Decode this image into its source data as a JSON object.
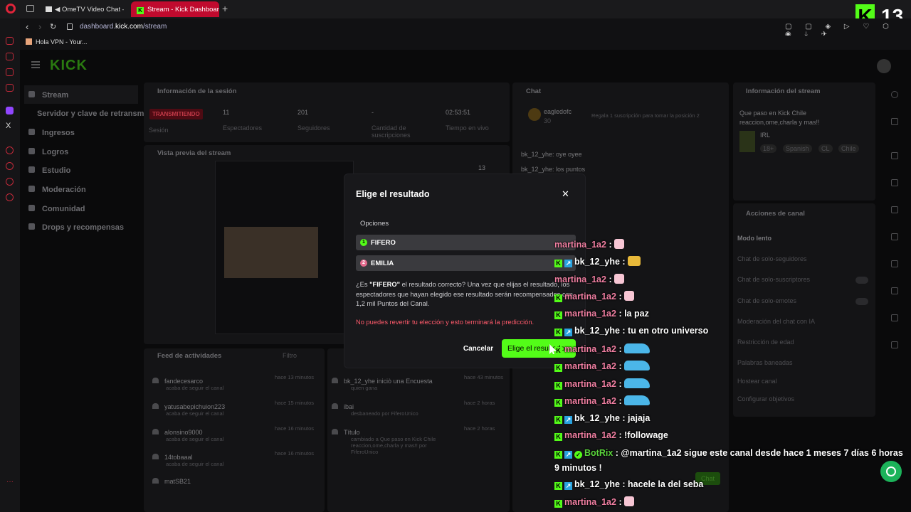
{
  "browser": {
    "tabs": [
      {
        "label": "OmeTV Video Chat —"
      },
      {
        "label": "Stream - Kick Dashboard"
      }
    ],
    "url_prefix": "dashboard.",
    "url_domain": "kick.com",
    "url_path": "/stream",
    "bookmark": "Hola VPN - Your..."
  },
  "overlay_counter": {
    "logo": "K",
    "value": "13"
  },
  "kick": {
    "logo_text": "KICK"
  },
  "sidebar": {
    "items": [
      {
        "label": "Stream"
      },
      {
        "label": "Servidor y clave de retransm"
      },
      {
        "label": "Ingresos"
      },
      {
        "label": "Logros"
      },
      {
        "label": "Estudio"
      },
      {
        "label": "Moderación"
      },
      {
        "label": "Comunidad"
      },
      {
        "label": "Drops y recompensas"
      }
    ]
  },
  "session": {
    "title": "Información de la sesión",
    "live_label": "TRANSMITIENDO",
    "session_label": "Sesión",
    "viewers": "11",
    "viewers_label": "Espectadores",
    "followers": "201",
    "followers_label": "Seguidores",
    "subs": "-",
    "subs_label": "Cantidad de suscripciones",
    "time": "02:53:51",
    "time_label": "Tiempo en vivo"
  },
  "preview": {
    "title": "Vista previa del stream",
    "count": "13"
  },
  "activity": {
    "title": "Feed de actividades",
    "filter": "Filtro",
    "items": [
      {
        "name": "fandecesarco",
        "desc": "acaba de seguir el canal",
        "time": "hace 13 minutos"
      },
      {
        "name": "yatusabepichuion223",
        "desc": "acaba de seguir el canal",
        "time": "hace 15 minutos"
      },
      {
        "name": "alonsino9000",
        "desc": "acaba de seguir el canal",
        "time": "hace 16 minutos"
      },
      {
        "name": "14tobaaal",
        "desc": "acaba de seguir el canal",
        "time": "hace 16 minutos"
      },
      {
        "name": "matSB21",
        "desc": "",
        "time": ""
      }
    ]
  },
  "mod_actions": {
    "items": [
      {
        "title": "bk_12_yhe iniciò una Encuesta",
        "desc": "quien gana",
        "time": "hace 43 minutos"
      },
      {
        "title": "ibai",
        "desc": "desbaneado por FiferoUnico",
        "time": "hace 2 horas"
      },
      {
        "title": "Título",
        "desc": "cambiado a Que paso en Kick Chile reaccion,ome,charla y mas!! por FiferoUnico",
        "time": "hace 2 horas"
      }
    ]
  },
  "chat_panel": {
    "title": "Chat",
    "top_user": "eagledofc",
    "top_amount": "30",
    "gift_hint": "Regala 1 suscripción para tomar la posición 2",
    "lines": [
      "bk_12_yhe: oye oyee",
      "bk_12_yhe: los puntos"
    ],
    "send": "Chat"
  },
  "stream_info": {
    "title": "Información del stream",
    "stream_title": "Que paso en Kick Chile reaccion,ome,charla y mas!!",
    "category": "IRL",
    "tags": [
      "18+",
      "Spanish",
      "CL",
      "Chile"
    ]
  },
  "channel_actions": {
    "title": "Acciones de canal",
    "items": [
      {
        "label": "Modo lento"
      },
      {
        "label": "Chat de solo-seguidores"
      },
      {
        "label": "Chat de solo-suscriptores"
      },
      {
        "label": "Chat de solo-emotes"
      },
      {
        "label": "Moderación del chat con IA"
      },
      {
        "label": "Restricción de edad"
      },
      {
        "label": "Palabras baneadas"
      },
      {
        "label": "Hostear canal"
      },
      {
        "label": "Configurar objetivos"
      }
    ]
  },
  "modal": {
    "title": "Elige el resultado",
    "options_label": "Opciones",
    "options": [
      {
        "num": "1",
        "label": "FIFERO",
        "color": "#53fc18"
      },
      {
        "num": "2",
        "label": "EMILIA",
        "color": "#e56b8e"
      }
    ],
    "body_pre": "¿Es ",
    "body_choice": "\"FIFERO\"",
    "body_post": " el resultado correcto? Una vez que elijas el resultado, los espectadores que hayan elegido ese resultado serán recompensados con 1,2 mil Puntos del Canal.",
    "warning": "No puedes revertir tu elección y esto terminará la predicción.",
    "cancel": "Cancelar",
    "confirm": "Elige el resultado"
  },
  "chat_overlay": {
    "messages": [
      {
        "user": "martina_1a2",
        "text": "",
        "emote": "bear"
      },
      {
        "user": "bk_12_yhe",
        "text": "",
        "emote": "frog"
      },
      {
        "user": "martina_1a2",
        "text": "",
        "emote": "bear"
      },
      {
        "user": "martina_1a2",
        "text": "",
        "emote": "bear"
      },
      {
        "user": "martina_1a2",
        "text": "la paz",
        "emote": ""
      },
      {
        "user": "bk_12_yhe",
        "text": "tu en otro universo",
        "emote": ""
      },
      {
        "user": "martina_1a2",
        "text": "",
        "emote": "car"
      },
      {
        "user": "martina_1a2",
        "text": "",
        "emote": "car"
      },
      {
        "user": "martina_1a2",
        "text": "",
        "emote": "car"
      },
      {
        "user": "martina_1a2",
        "text": "",
        "emote": "car"
      },
      {
        "user": "bk_12_yhe",
        "text": "jajaja",
        "emote": ""
      },
      {
        "user": "martina_1a2",
        "text": "!followage",
        "emote": ""
      },
      {
        "user": "BotRix",
        "text": "@martina_1a2 sigue este canal desde hace 1 meses 7 días 6 horas 9 minutos !",
        "emote": ""
      },
      {
        "user": "bk_12_yhe",
        "text": "hacele la del seba",
        "emote": ""
      },
      {
        "user": "martina_1a2",
        "text": "",
        "emote": "bear"
      }
    ]
  },
  "colors": {
    "kick_green": "#53fc18",
    "warn_red": "#ff5a6b",
    "pink_user": "#f07fa2"
  }
}
